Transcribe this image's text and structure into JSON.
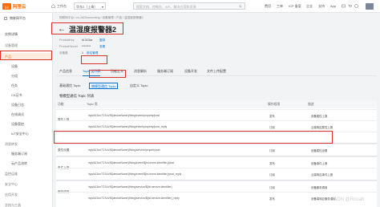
{
  "topbar": {
    "logo_mark": "[-]",
    "logo_text": "阿里云",
    "workspace": "工作台",
    "region": "华东2（上海）",
    "search_placeholder": "搜索文档、控制台、API、解决方案和资源",
    "links": [
      "费用",
      "工单",
      "ICP 备案",
      "企业",
      "支持",
      "App"
    ]
  },
  "sidebar": {
    "items": [
      {
        "label": "物联网平台",
        "type": "header"
      },
      {
        "label": "实例详情",
        "type": "item"
      },
      {
        "label": "设备管理",
        "type": "group"
      },
      {
        "label": "产品",
        "type": "sub-active"
      },
      {
        "label": "设备",
        "type": "sub"
      },
      {
        "label": "分组",
        "type": "sub"
      },
      {
        "label": "任务",
        "type": "sub"
      },
      {
        "label": "CA证书",
        "type": "sub"
      },
      {
        "label": "设备日志",
        "type": "sub"
      },
      {
        "label": "在线调试",
        "type": "sub"
      },
      {
        "label": "设备管控",
        "type": "sub"
      },
      {
        "label": "IoT安全中心",
        "type": "sub"
      },
      {
        "label": "消息转发",
        "type": "group"
      },
      {
        "label": "服务端订阅",
        "type": "sub"
      },
      {
        "label": "云产品流转",
        "type": "sub"
      },
      {
        "label": "监控运维",
        "type": "group"
      },
      {
        "label": "安全中心",
        "type": "group"
      },
      {
        "label": "应用开发",
        "type": "group"
      },
      {
        "label": "文档与工具",
        "type": "group"
      }
    ]
  },
  "breadcrumb": "物联网平台 / cn-2d23xxxxxxkng / 设备管理 / 产品 / 温湿度报警器2",
  "title": "温湿度报警器2",
  "meta": {
    "product_key_label": "ProductKey",
    "product_key_value": "k13C5ar",
    "copy_label": "复制",
    "product_secret_label": "ProductSecret",
    "product_secret_value": "********",
    "view_label": "查看",
    "device_count_label": "设备数",
    "device_count_value": "1",
    "manage_label": "前往管理"
  },
  "tabs": [
    "产品信息",
    "Topic 类列表",
    "功能定义",
    "消息解析",
    "服务端订阅",
    "设备开发",
    "文件上传配置"
  ],
  "active_tab": 1,
  "subtabs": [
    "基础通信 Topic",
    "物模型通信 Topic",
    "自定义 Topic"
  ],
  "active_subtab": 1,
  "section_title": "物模型通信 Topic 列表",
  "table": {
    "headers": [
      "功能",
      "Topic 类",
      "操作权限",
      "描述"
    ],
    "rows": [
      {
        "func": "",
        "topic": "/sys/k13cn7CSuV/${deviceName}/thing/event/property/post",
        "perm": "发布",
        "desc": "设备属性上报"
      },
      {
        "func": "属性上报",
        "topic": "/sys/k13cn7CSuV/${deviceName}/thing/event/property/post_reply",
        "perm": "订阅",
        "desc": "云端响应属性上报"
      },
      {
        "func": "",
        "topic": "",
        "perm": "",
        "desc": ""
      },
      {
        "func": "属性设置",
        "topic": "/sys/k13cn7CSuV/${deviceName}/thing/service/property/set",
        "perm": "订阅",
        "desc": "设备属性设置"
      },
      {
        "func": "",
        "topic": "/sys/k13cn7CSuV/${deviceName}/thing/event/${tsl.event.identifier}/post",
        "perm": "发布",
        "desc": "设备事件上报"
      },
      {
        "func": "事件上报",
        "topic": "/sys/k13cn7CSuV/${deviceName}/thing/event/${tsl.event.identifier}/post_reply",
        "perm": "订阅",
        "desc": "云端响应事件上报"
      },
      {
        "func": "",
        "topic": "/sys/k13cn7CSuV/${deviceName}/thing/service/${tsl.service.identifier}",
        "perm": "订阅",
        "desc": "设备服务调用"
      },
      {
        "func": "服务调用",
        "topic": "/sys/k13cn7CSuV/${deviceName}/thing/service/${tsl.service.identifier}_reply",
        "perm": "发布",
        "desc": "设备端响应服务调用"
      }
    ]
  },
  "watermark": "CSDN @Rnoah",
  "colors": {
    "accent": "#ff6a00",
    "link": "#0070cc",
    "annotation": "#d9322b"
  }
}
